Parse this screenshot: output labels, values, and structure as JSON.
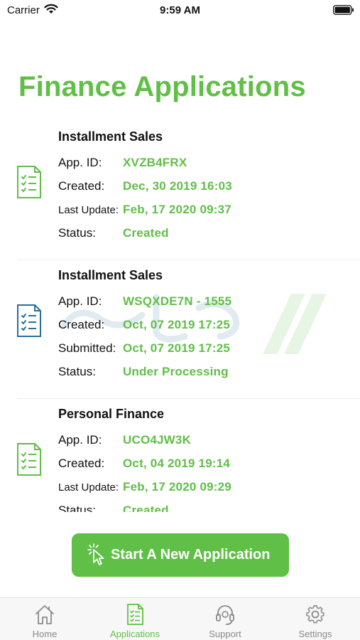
{
  "status_bar": {
    "carrier": "Carrier",
    "time": "9:59 AM"
  },
  "page_title": "Finance Applications",
  "applications": [
    {
      "title": "Installment Sales",
      "icon": "document-list-icon",
      "icon_color": "#5fbf46",
      "fields": [
        {
          "label": "App. ID:",
          "value": "XVZB4FRX"
        },
        {
          "label": "Created:",
          "value": "Dec, 30 2019 16:03"
        },
        {
          "label": "Last Update:",
          "value": "Feb, 17 2020 09:37"
        },
        {
          "label": "Status:",
          "value": "Created"
        }
      ]
    },
    {
      "title": "Installment Sales",
      "icon": "document-list-icon",
      "icon_color": "#2a6f9b",
      "fields": [
        {
          "label": "App. ID:",
          "value": "WSQXDE7N - 1555"
        },
        {
          "label": "Created:",
          "value": "Oct, 07 2019 17:25"
        },
        {
          "label": "Submitted:",
          "value": "Oct, 07 2019 17:25"
        },
        {
          "label": "Status:",
          "value": "Under Processing"
        }
      ]
    },
    {
      "title": "Personal Finance",
      "icon": "document-list-icon",
      "icon_color": "#5fbf46",
      "fields": [
        {
          "label": "App. ID:",
          "value": "UCO4JW3K"
        },
        {
          "label": "Created:",
          "value": "Oct, 04 2019 19:14"
        },
        {
          "label": "Last Update:",
          "value": "Feb, 17 2020 09:29"
        },
        {
          "label": "Status:",
          "value": "Created"
        }
      ]
    }
  ],
  "cta": {
    "label": "Start A New Application",
    "icon": "pointer-click-icon"
  },
  "tabs": [
    {
      "label": "Home",
      "icon": "home-icon",
      "active": false
    },
    {
      "label": "Applications",
      "icon": "document-list-icon",
      "active": true
    },
    {
      "label": "Support",
      "icon": "headset-icon",
      "active": false
    },
    {
      "label": "Settings",
      "icon": "gear-icon",
      "active": false
    }
  ],
  "colors": {
    "accent": "#5fbf46",
    "secondary_icon": "#2a6f9b",
    "tab_inactive": "#8a8a8a"
  }
}
